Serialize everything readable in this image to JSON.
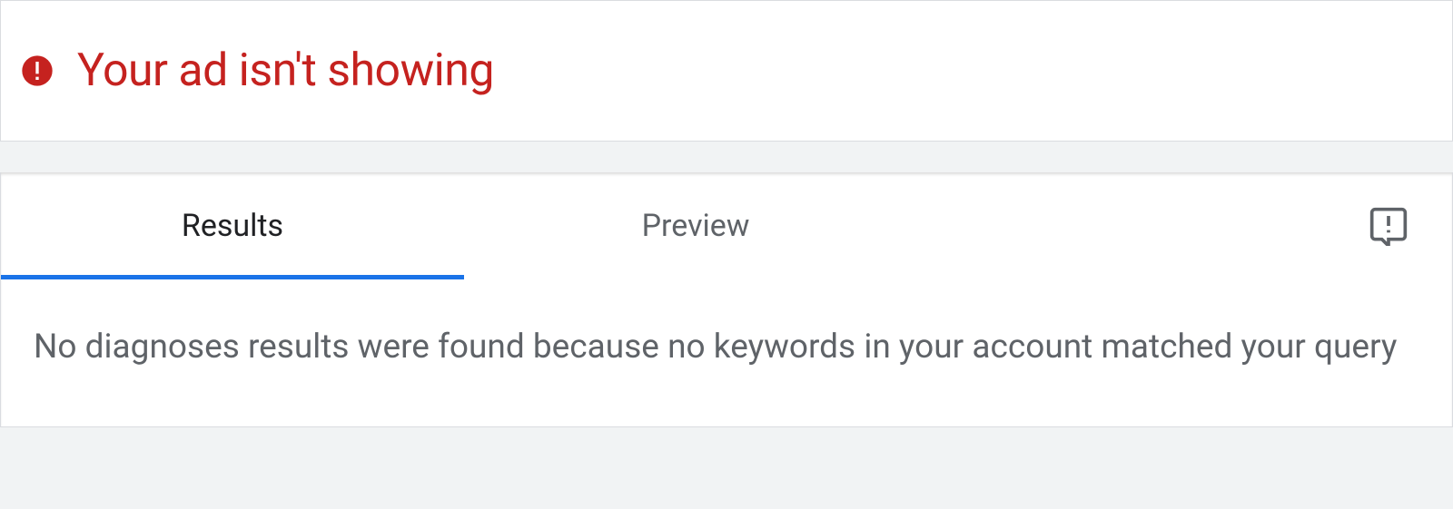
{
  "banner": {
    "title": "Your ad isn't showing"
  },
  "tabs": [
    {
      "label": "Results",
      "active": true
    },
    {
      "label": "Preview",
      "active": false
    }
  ],
  "results": {
    "message": "No diagnoses results were found because no keywords in your account matched your query"
  },
  "colors": {
    "error": "#c5221f",
    "accent": "#1a73e8",
    "text_secondary": "#5f6368"
  }
}
